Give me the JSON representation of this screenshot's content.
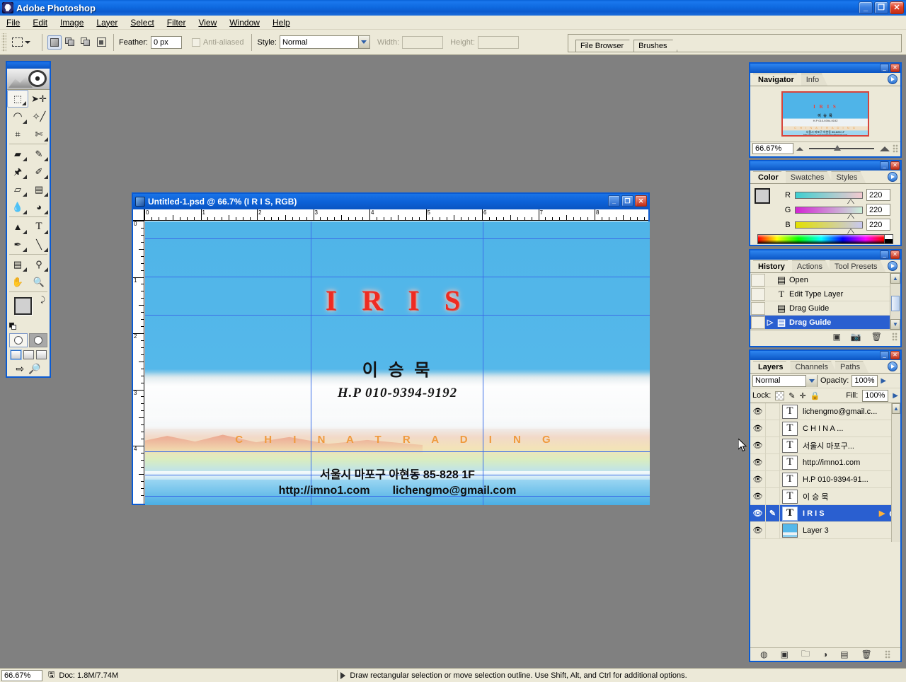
{
  "app": {
    "title": "Adobe Photoshop",
    "icon": "photoshop-icon",
    "window_buttons": {
      "minimize": "_",
      "maximize": "❐",
      "close": "✕"
    }
  },
  "menubar": {
    "items": [
      "File",
      "Edit",
      "Image",
      "Layer",
      "Select",
      "Filter",
      "View",
      "Window",
      "Help"
    ]
  },
  "options_bar": {
    "tool_preset_icon": "rectangular-marquee-icon",
    "selection_modes": [
      "new-selection",
      "add-to-selection",
      "subtract-from-selection",
      "intersect-with-selection"
    ],
    "feather_label": "Feather:",
    "feather_value": "0 px",
    "antialiased_label": "Anti-aliased",
    "style_label": "Style:",
    "style_value": "Normal",
    "width_label": "Width:",
    "width_value": "",
    "height_label": "Height:",
    "height_value": ""
  },
  "palette_well": {
    "tabs": [
      "File Browser",
      "Brushes"
    ]
  },
  "toolbox": {
    "tools": [
      "rectangular-marquee",
      "move",
      "lasso",
      "magic-wand",
      "crop",
      "slice",
      "healing-brush",
      "brush",
      "clone-stamp",
      "history-brush",
      "eraser",
      "gradient",
      "blur",
      "dodge",
      "path-selection",
      "type",
      "pen",
      "line-shape",
      "notes",
      "eyedropper",
      "hand",
      "zoom"
    ],
    "foreground_color": "#d0d0d0",
    "background_color": "#ccd9ec",
    "mask_modes": [
      "standard-mask-mode",
      "quick-mask-mode"
    ],
    "screen_modes": [
      "standard-screen-mode",
      "full-screen-with-menubar",
      "full-screen"
    ],
    "jump_to": [
      "jump-to-imageready",
      "jump-to-other"
    ]
  },
  "document": {
    "title": "Untitled-1.psd @ 66.7% (I R I S, RGB)",
    "window_buttons": {
      "minimize": "_",
      "maximize": "❐",
      "close": "✕"
    },
    "ruler_units_h": [
      "0",
      "1",
      "2",
      "3",
      "4",
      "5",
      "6",
      "7",
      "8"
    ],
    "ruler_units_v": [
      "0",
      "1",
      "2",
      "3",
      "4"
    ],
    "canvas": {
      "title_text": "I R I S",
      "name_text": "이 승 묵",
      "phone_text": "H.P 010-9394-9192",
      "company_text": "C H I N A T R A D I N G",
      "address_text": "서울시 마포구 아현동 85-828 1F",
      "website_text": "http://imno1.com",
      "email_text": "lichengmo@gmail.com",
      "title_color": "#ee2b22",
      "company_color": "#ef9a3e",
      "sky_color": "#55b6e8"
    }
  },
  "navigator": {
    "tabs": [
      "Navigator",
      "Info"
    ],
    "active_tab": "Navigator",
    "zoom_value": "66.67%",
    "thumb": {
      "title": "I R I S",
      "name": "이 승 묵",
      "phone": "H.P 010-9394-9192",
      "company": "C H I N A T R A D I N G",
      "address": "서울시 마포구 아현동 85-828 1F",
      "web": "http://imno1.com   lichengmo@gmail.com"
    }
  },
  "color": {
    "tabs": [
      "Color",
      "Swatches",
      "Styles"
    ],
    "active_tab": "Color",
    "channels": [
      {
        "label": "R",
        "value": "220"
      },
      {
        "label": "G",
        "value": "220"
      },
      {
        "label": "B",
        "value": "220"
      }
    ]
  },
  "history": {
    "tabs": [
      "History",
      "Actions",
      "Tool Presets"
    ],
    "active_tab": "History",
    "items": [
      {
        "label": "Open",
        "icon": "document-icon",
        "active": false,
        "marker": false
      },
      {
        "label": "Edit Type Layer",
        "icon": "type-icon",
        "active": false,
        "marker": false
      },
      {
        "label": "Drag Guide",
        "icon": "document-icon",
        "active": false,
        "marker": false
      },
      {
        "label": "Drag Guide",
        "icon": "document-icon",
        "active": true,
        "marker": true
      }
    ],
    "footer_icons": [
      "new-document-icon",
      "new-snapshot-icon",
      "trash-icon"
    ]
  },
  "layers": {
    "tabs": [
      "Layers",
      "Channels",
      "Paths"
    ],
    "active_tab": "Layers",
    "blend_mode": "Normal",
    "opacity_label": "Opacity:",
    "opacity_value": "100%",
    "lock_label": "Lock:",
    "fill_label": "Fill:",
    "fill_value": "100%",
    "lock_icons": [
      "lock-transparent-icon",
      "lock-image-icon",
      "lock-position-icon",
      "lock-all-icon"
    ],
    "items": [
      {
        "name": "lichengmo@gmail.c...",
        "type": "T",
        "visible": true,
        "selected": false,
        "linked": false
      },
      {
        "name": "C  H  I  N  A ...",
        "type": "T",
        "visible": true,
        "selected": false,
        "linked": false
      },
      {
        "name": "서울시 마포구...",
        "type": "T",
        "visible": true,
        "selected": false,
        "linked": false
      },
      {
        "name": "http://imno1.com",
        "type": "T",
        "visible": true,
        "selected": false,
        "linked": false
      },
      {
        "name": "H.P 010-9394-91...",
        "type": "T",
        "visible": true,
        "selected": false,
        "linked": false
      },
      {
        "name": "이 승 묵",
        "type": "T",
        "visible": true,
        "selected": false,
        "linked": false
      },
      {
        "name": "I R I S",
        "type": "T",
        "visible": true,
        "selected": true,
        "linked": true
      },
      {
        "name": "Layer 3",
        "type": "image",
        "visible": true,
        "selected": false,
        "linked": false
      }
    ],
    "footer_icons": [
      "link-styles-icon",
      "layer-mask-icon",
      "new-group-icon",
      "adjustment-layer-icon",
      "new-layer-icon",
      "delete-layer-icon"
    ]
  },
  "statusbar": {
    "zoom": "66.67%",
    "doc_icon": "document-size-icon",
    "doc_info": "Doc: 1.8M/7.74M",
    "hint": "Draw rectangular selection or move selection outline.  Use Shift, Alt, and Ctrl for additional options."
  }
}
